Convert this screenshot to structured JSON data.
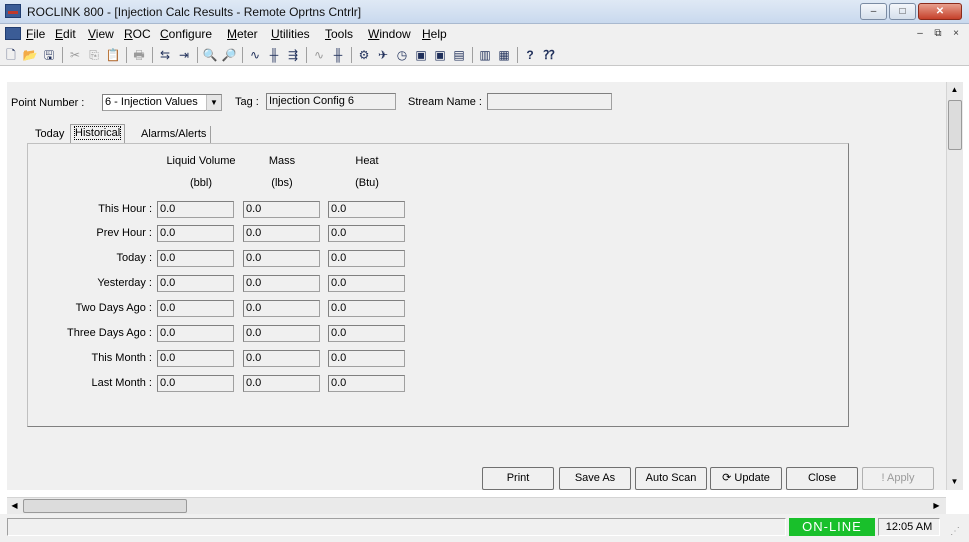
{
  "window": {
    "title": "ROCLINK 800 - [Injection Calc Results - Remote Oprtns Cntrlr]",
    "minimize_label": "–",
    "maximize_label": "□",
    "close_label": "✕"
  },
  "menu": {
    "items": [
      "File",
      "Edit",
      "View",
      "ROC",
      "Configure",
      "Meter",
      "Utilities",
      "Tools",
      "Window",
      "Help"
    ],
    "mdi_minimize": "–",
    "mdi_restore": "⧉",
    "mdi_close": "×"
  },
  "toolbar": {
    "icons": [
      "new-icon",
      "open-icon",
      "save-icon",
      "cut-icon",
      "copy-icon",
      "paste-icon",
      "print-icon",
      "connect-icon",
      "direct-connect-icon",
      "zoom-in-icon",
      "zoom-out-icon",
      "trend-icon",
      "io-icon",
      "signal-icon",
      "pid-icon",
      "fst-icon",
      "flow-icon",
      "meter-icon",
      "clock-icon",
      "device-icon",
      "station-icon",
      "comm-icon",
      "chart-icon",
      "report-icon",
      "help-icon",
      "context-help-icon"
    ],
    "glyphs": [
      "🗋",
      "📂",
      "🖫",
      "✂",
      "⎘",
      "📋",
      "🖶",
      "⇆",
      "⇥",
      "🔍",
      "🔎",
      "∿",
      "╫",
      "⇶",
      "∿",
      "╫",
      "⚙",
      "✈",
      "◷",
      "▣",
      "▣",
      "▤",
      "▥",
      "▦",
      "?",
      "⁇"
    ]
  },
  "point": {
    "number_label": "Point Number :",
    "number_value": "6 - Injection Values",
    "tag_label": "Tag :",
    "tag_value": "Injection Config 6",
    "stream_label": "Stream Name :",
    "stream_value": ""
  },
  "tabs": [
    {
      "label": "Today",
      "active": false
    },
    {
      "label": "Historical",
      "active": true
    },
    {
      "label": "Alarms/Alerts",
      "active": false
    }
  ],
  "table": {
    "columns": [
      {
        "name": "Liquid Volume",
        "unit": "(bbl)"
      },
      {
        "name": "Mass",
        "unit": "(lbs)"
      },
      {
        "name": "Heat",
        "unit": "(Btu)"
      }
    ],
    "rows": [
      {
        "label": "This Hour :",
        "values": [
          "0.0",
          "0.0",
          "0.0"
        ]
      },
      {
        "label": "Prev Hour :",
        "values": [
          "0.0",
          "0.0",
          "0.0"
        ]
      },
      {
        "label": "Today :",
        "values": [
          "0.0",
          "0.0",
          "0.0"
        ]
      },
      {
        "label": "Yesterday :",
        "values": [
          "0.0",
          "0.0",
          "0.0"
        ]
      },
      {
        "label": "Two Days Ago :",
        "values": [
          "0.0",
          "0.0",
          "0.0"
        ]
      },
      {
        "label": "Three Days Ago :",
        "values": [
          "0.0",
          "0.0",
          "0.0"
        ]
      },
      {
        "label": "This Month :",
        "values": [
          "0.0",
          "0.0",
          "0.0"
        ]
      },
      {
        "label": "Last Month :",
        "values": [
          "0.0",
          "0.0",
          "0.0"
        ]
      }
    ]
  },
  "buttons": {
    "print": "Print",
    "save_as": "Save As",
    "auto_scan": "Auto Scan",
    "update": "Update",
    "close": "Close",
    "apply": "Apply"
  },
  "status": {
    "connection": "ON-LINE",
    "time": "12:05 AM",
    "online_color": "#19c02b"
  }
}
